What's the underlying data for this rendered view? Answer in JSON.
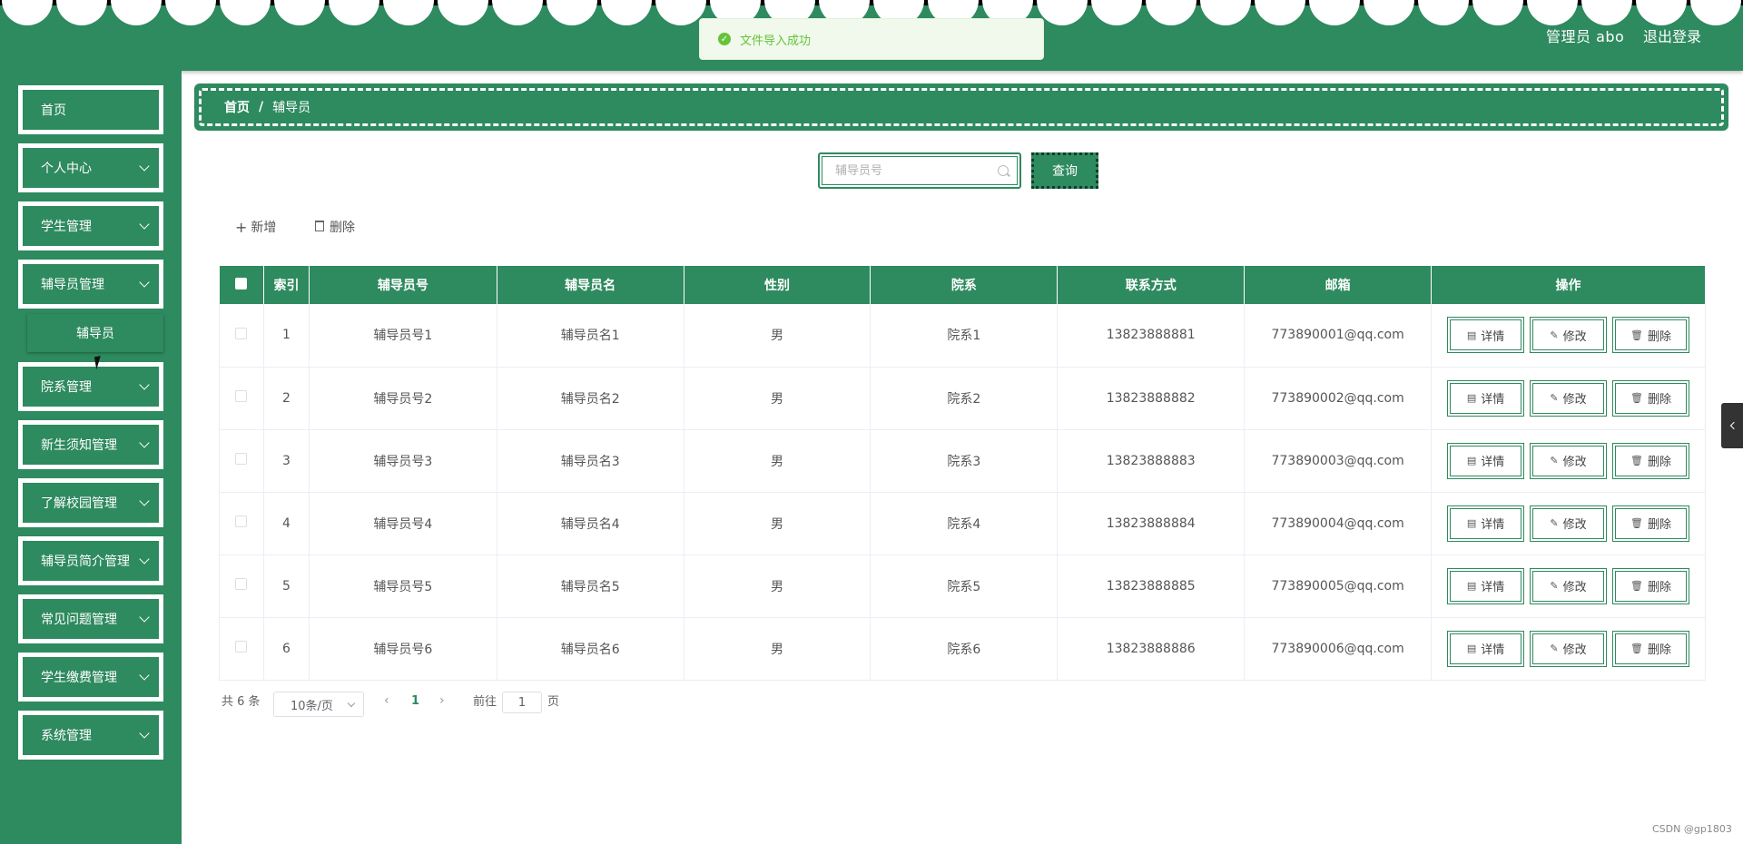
{
  "header": {
    "user_label": "管理员 abo",
    "logout_label": "退出登录",
    "bg_color": "#2e8a5f"
  },
  "toast": {
    "icon": "check-circle-icon",
    "message": "文件导入成功"
  },
  "sidebar": {
    "items": [
      {
        "label": "首页",
        "has_children": false
      },
      {
        "label": "个人中心",
        "has_children": true
      },
      {
        "label": "学生管理",
        "has_children": true
      },
      {
        "label": "辅导员管理",
        "has_children": true
      },
      {
        "label": "院系管理",
        "has_children": true
      },
      {
        "label": "新生须知管理",
        "has_children": true
      },
      {
        "label": "了解校园管理",
        "has_children": true
      },
      {
        "label": "辅导员简介管理",
        "has_children": true
      },
      {
        "label": "常见问题管理",
        "has_children": true
      },
      {
        "label": "学生缴费管理",
        "has_children": true
      },
      {
        "label": "系统管理",
        "has_children": true
      }
    ],
    "submenu": {
      "label": "辅导员"
    }
  },
  "breadcrumb": {
    "home": "首页",
    "separator": "/",
    "current": "辅导员"
  },
  "search": {
    "placeholder": "辅导员号",
    "value": "",
    "button_label": "查询"
  },
  "actions": {
    "add_label": "新增",
    "delete_label": "删除"
  },
  "table": {
    "columns": [
      "索引",
      "辅导员号",
      "辅导员名",
      "性别",
      "院系",
      "联系方式",
      "邮箱",
      "操作"
    ],
    "rows": [
      {
        "index": "1",
        "code": "辅导员号1",
        "name": "辅导员名1",
        "gender": "男",
        "dept": "院系1",
        "phone": "13823888881",
        "email": "773890001@qq.com"
      },
      {
        "index": "2",
        "code": "辅导员号2",
        "name": "辅导员名2",
        "gender": "男",
        "dept": "院系2",
        "phone": "13823888882",
        "email": "773890002@qq.com"
      },
      {
        "index": "3",
        "code": "辅导员号3",
        "name": "辅导员名3",
        "gender": "男",
        "dept": "院系3",
        "phone": "13823888883",
        "email": "773890003@qq.com"
      },
      {
        "index": "4",
        "code": "辅导员号4",
        "name": "辅导员名4",
        "gender": "男",
        "dept": "院系4",
        "phone": "13823888884",
        "email": "773890004@qq.com"
      },
      {
        "index": "5",
        "code": "辅导员号5",
        "name": "辅导员名5",
        "gender": "男",
        "dept": "院系5",
        "phone": "13823888885",
        "email": "773890005@qq.com"
      },
      {
        "index": "6",
        "code": "辅导员号6",
        "name": "辅导员名6",
        "gender": "男",
        "dept": "院系6",
        "phone": "13823888886",
        "email": "773890006@qq.com"
      }
    ],
    "row_actions": {
      "detail": "详情",
      "edit": "修改",
      "delete": "删除"
    }
  },
  "pagination": {
    "total_label": "共 6 条",
    "page_size": "10条/页",
    "current_page": "1",
    "goto_prefix": "前往",
    "goto_value": "1",
    "goto_suffix": "页"
  },
  "watermark": "CSDN @gp1803"
}
